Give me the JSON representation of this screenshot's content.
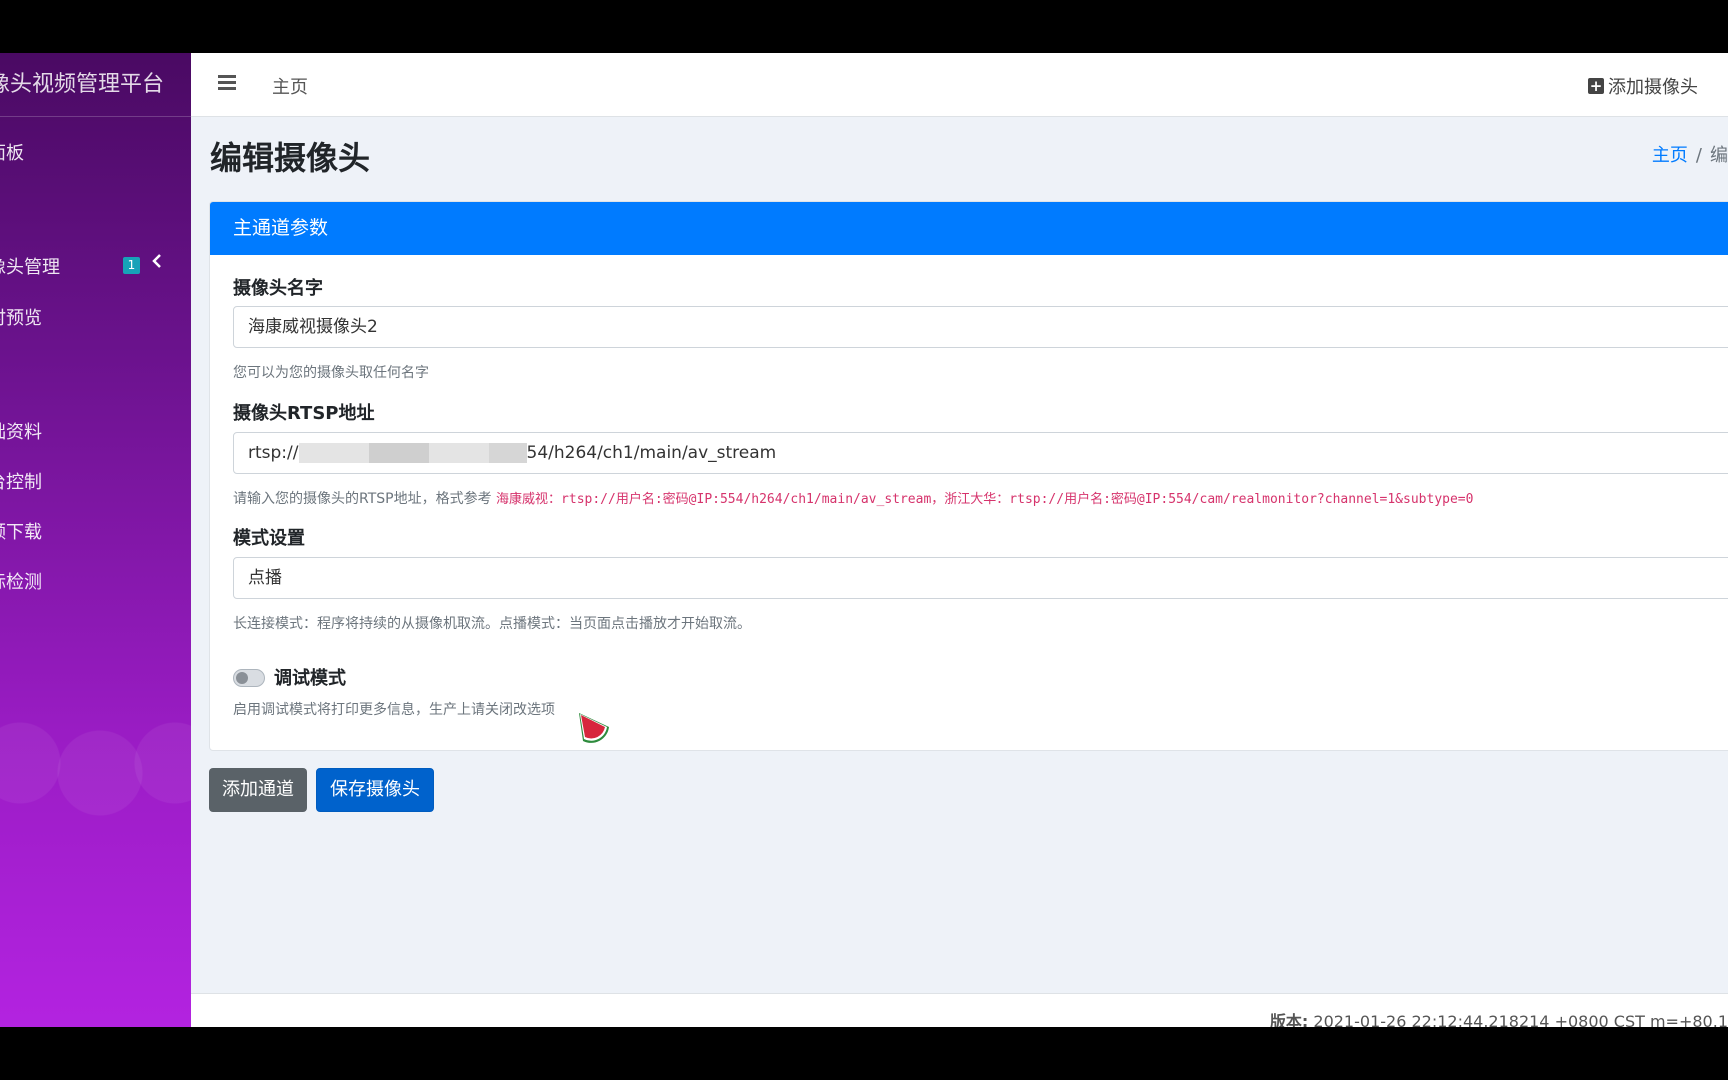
{
  "sidebar": {
    "brand": "像头视频管理平台",
    "items": [
      {
        "label": "面板"
      },
      {
        "label": "像头管理",
        "badge": "1"
      },
      {
        "label": "时预览"
      },
      {
        "label": "础资料"
      },
      {
        "label": "台控制"
      },
      {
        "label": "频下载"
      },
      {
        "label": "标检测"
      }
    ],
    "gradient_colors": [
      "#4a0a63",
      "#b323e0"
    ]
  },
  "topbar": {
    "home_label": "主页",
    "add_camera_label": "添加摄像头",
    "icons": [
      "hamburger-icon",
      "plus-square-icon"
    ]
  },
  "page": {
    "title": "编辑摄像头",
    "breadcrumb": {
      "home": "主页",
      "separator": "/",
      "current": "编"
    }
  },
  "card": {
    "header": "主通道参数",
    "header_color": "#007bff",
    "fields": {
      "name": {
        "label": "摄像头名字",
        "value": "海康威视摄像头2",
        "help": "您可以为您的摄像头取任何名字"
      },
      "rtsp": {
        "label": "摄像头RTSP地址",
        "value_prefix": "rtsp://",
        "value_suffix": "54/h264/ch1/main/av_stream",
        "help_prefix": "请输入您的摄像头的RTSP地址，格式参考",
        "help_code": "海康威视：rtsp://用户名:密码@IP:554/h264/ch1/main/av_stream，浙江大华：rtsp://用户名:密码@IP:554/cam/realmonitor?channel=1&subtype=0"
      },
      "mode": {
        "label": "模式设置",
        "value": "点播",
        "help": "长连接模式：程序将持续的从摄像机取流。点播模式：当页面点击播放才开始取流。"
      },
      "debug": {
        "label": "调试模式",
        "checked": false,
        "help": "启用调试模式将打印更多信息，生产上请关闭改选项"
      }
    }
  },
  "buttons": {
    "add_channel": "添加通道",
    "save_camera": "保存摄像头"
  },
  "footer": {
    "version_label": "版本:",
    "version_value": "2021-01-26 22:12:44.218214 +0800 CST m=+80.1"
  }
}
